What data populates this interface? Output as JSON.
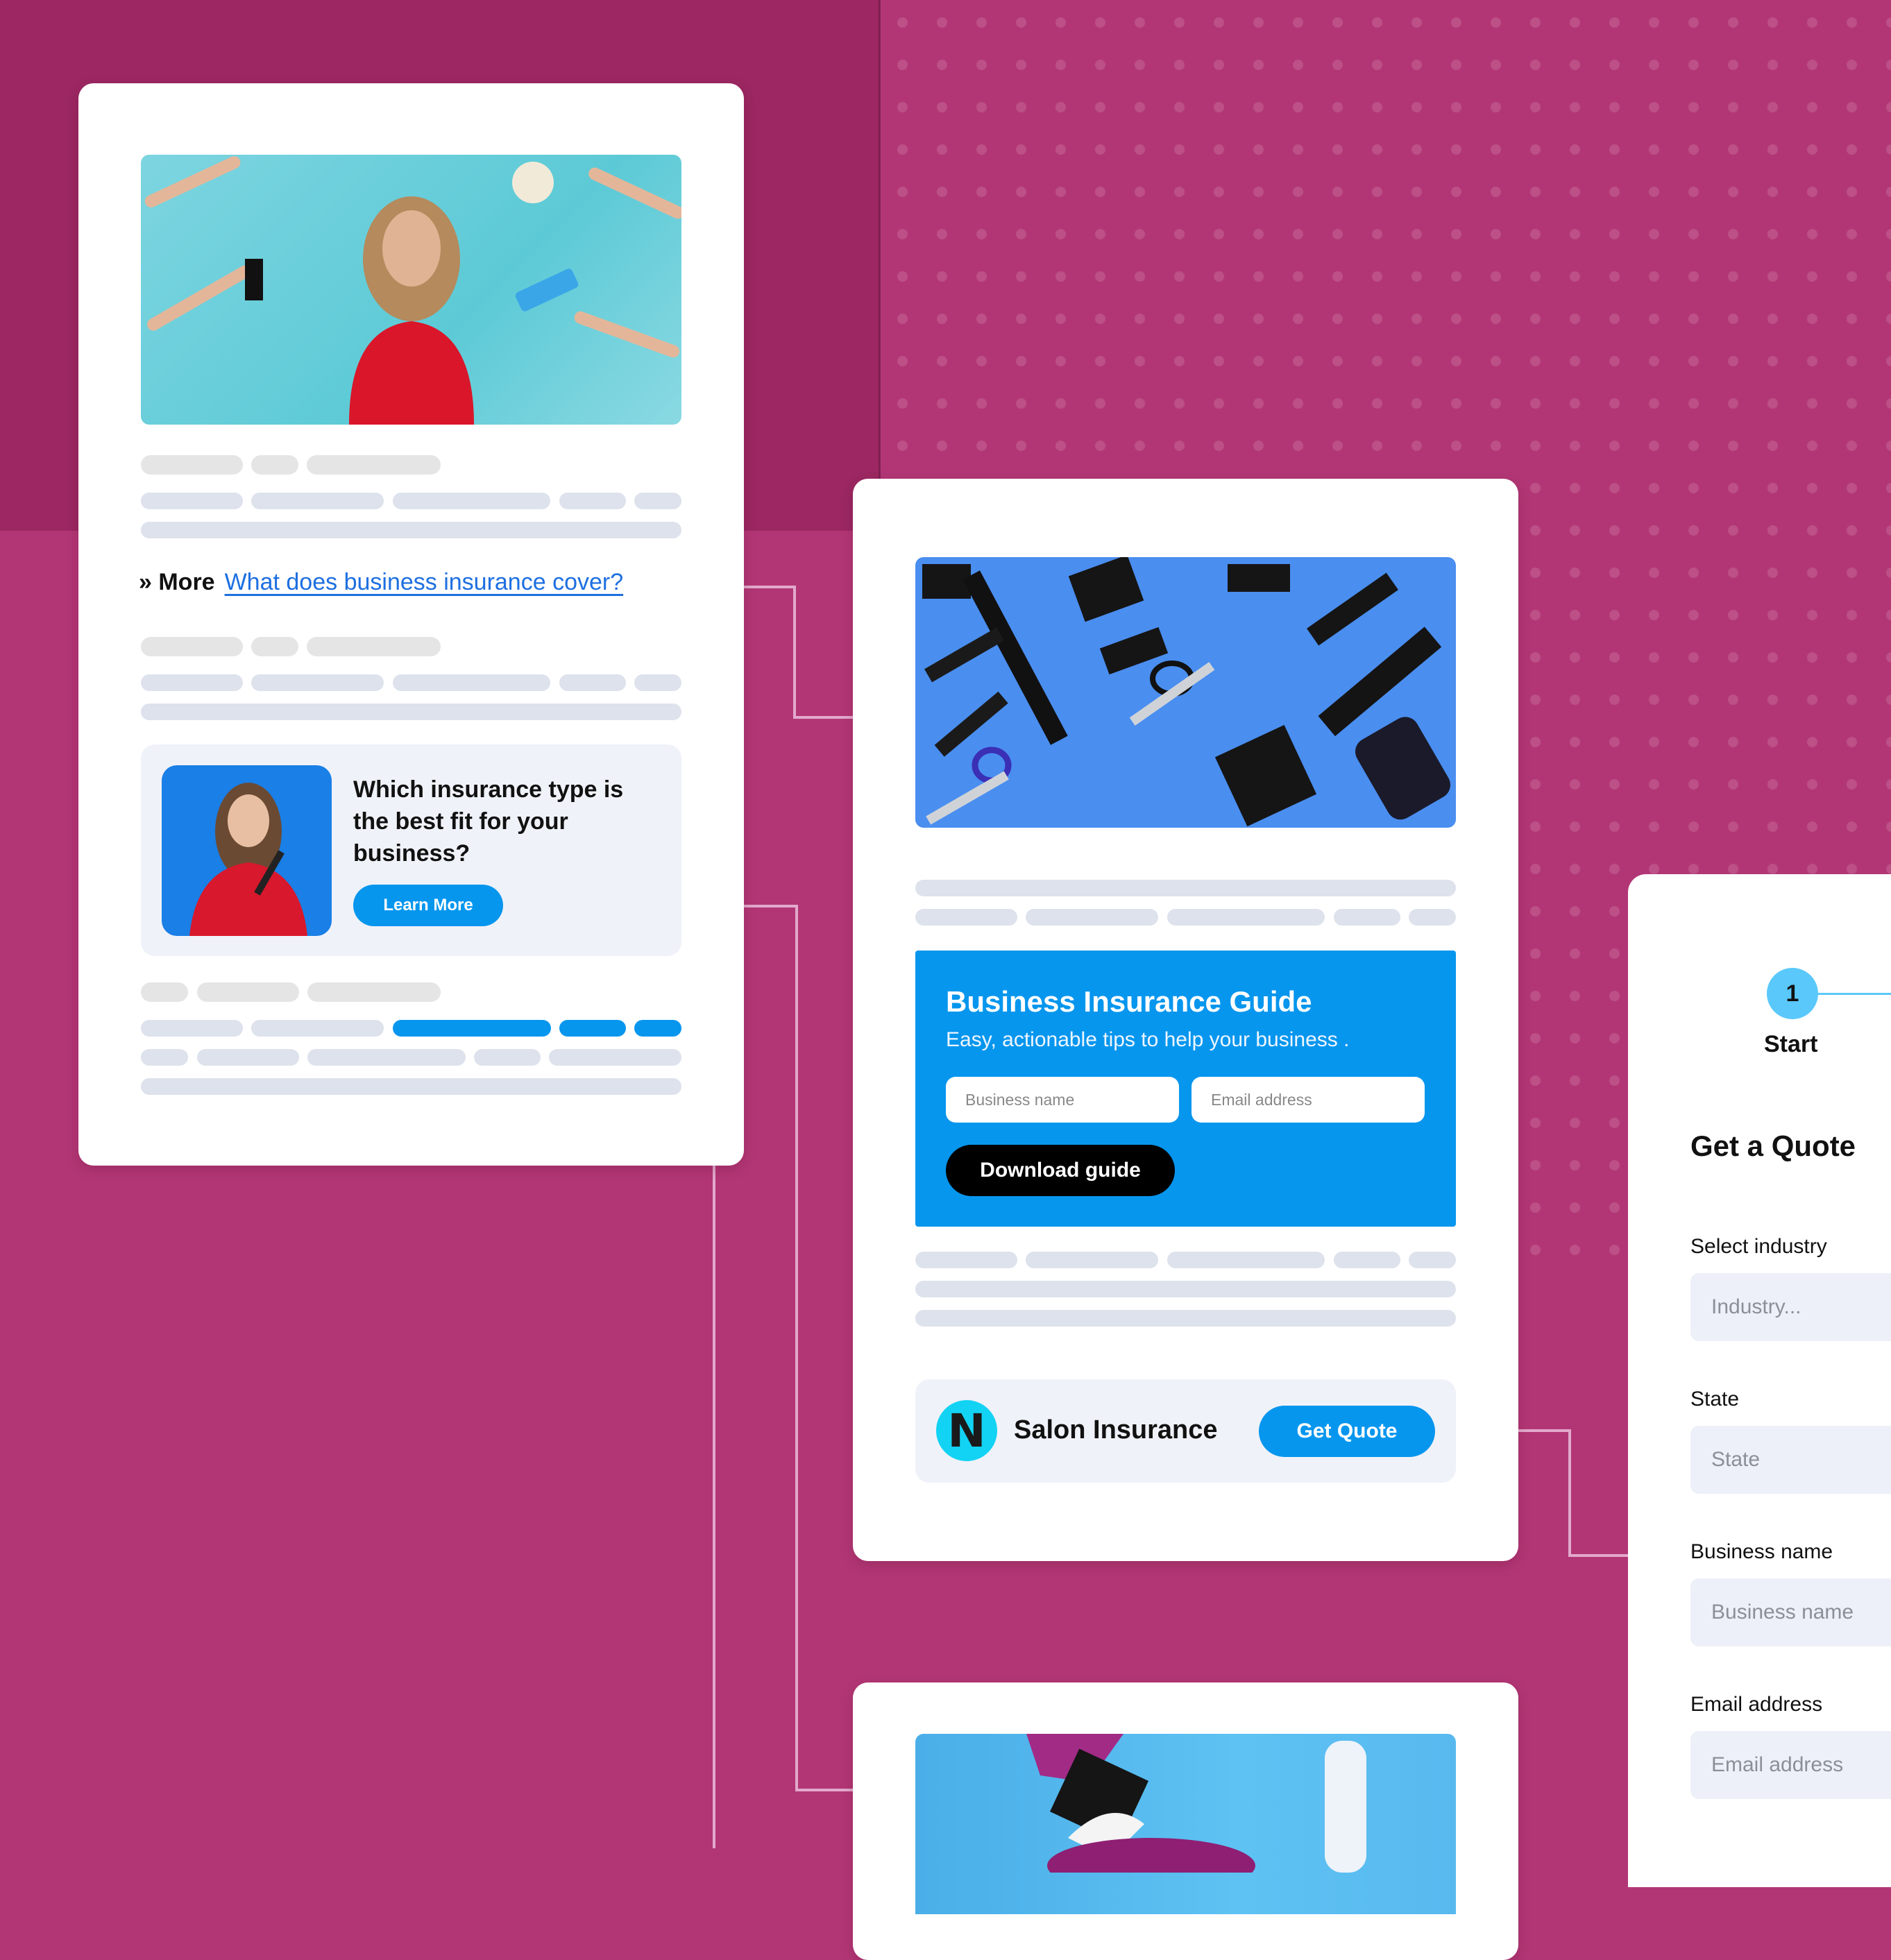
{
  "colors": {
    "background": "#b23675",
    "background_dark": "#9c2762",
    "accent_blue": "#0796ee",
    "link_blue": "#1d6fe0",
    "connector": "#e2a9cc",
    "step_blue": "#5ac8fa",
    "logo_cyan": "#12d3f3"
  },
  "article_card": {
    "hero_image": "woman-with-salon-tools-photo",
    "more_prefix": "» More",
    "more_link": "What does business insurance cover?",
    "promo": {
      "image": "woman-holding-makeup-brushes-photo",
      "title": "Which insurance type is the best fit for your business?",
      "button": "Learn More"
    }
  },
  "guide_card": {
    "hero_image": "hair-tools-flatlay-photo",
    "guide": {
      "title": "Business Insurance Guide",
      "subtitle": "Easy, actionable tips to help your business .",
      "business_placeholder": "Business name",
      "email_placeholder": "Email address",
      "button": "Download guide"
    },
    "product": {
      "logo_letter": "N",
      "name": "Salon Insurance",
      "button": "Get Quote"
    }
  },
  "third_card": {
    "hero_image": "hair-dye-brush-bowl-photo"
  },
  "quote_form": {
    "step_number": "1",
    "step_label": "Start",
    "title": "Get a Quote",
    "fields": [
      {
        "label": "Select industry",
        "placeholder": "Industry..."
      },
      {
        "label": "State",
        "placeholder": "State"
      },
      {
        "label": "Business name",
        "placeholder": "Business name"
      },
      {
        "label": "Email address",
        "placeholder": "Email address"
      }
    ]
  }
}
